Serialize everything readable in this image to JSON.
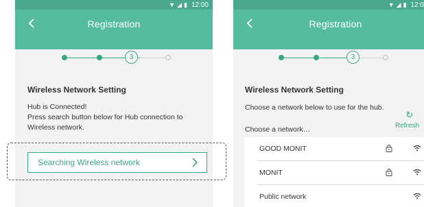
{
  "left": {
    "status_time": "12:00",
    "header_title": "Registration",
    "step_current": "3",
    "section_title": "Wireless Network Setting",
    "desc_lines": [
      "Hub is Connected!",
      "Press search button below for Hub connection to",
      "Wireless network."
    ],
    "search_button_label": "Searching Wireless network"
  },
  "right": {
    "status_time": "12:0",
    "header_title": "Registration",
    "step_current": "3",
    "section_title": "Wireless Network Setting",
    "desc": "Choose a network below to use for the hub.",
    "choose_label": "Choose a network…",
    "refresh_label": "Refresh",
    "networks": [
      {
        "name": "GOOD MONIT",
        "locked": true
      },
      {
        "name": "MONIT",
        "locked": true
      },
      {
        "name": "Public network",
        "locked": false
      }
    ]
  },
  "colors": {
    "header": "#56bc9f",
    "status_bar": "#4aa88f",
    "accent": "#3aa784"
  },
  "icons": [
    "wifi-icon",
    "signal-icon",
    "battery-icon",
    "back-arrow-icon",
    "chevron-right-icon",
    "refresh-icon",
    "lock-icon"
  ]
}
